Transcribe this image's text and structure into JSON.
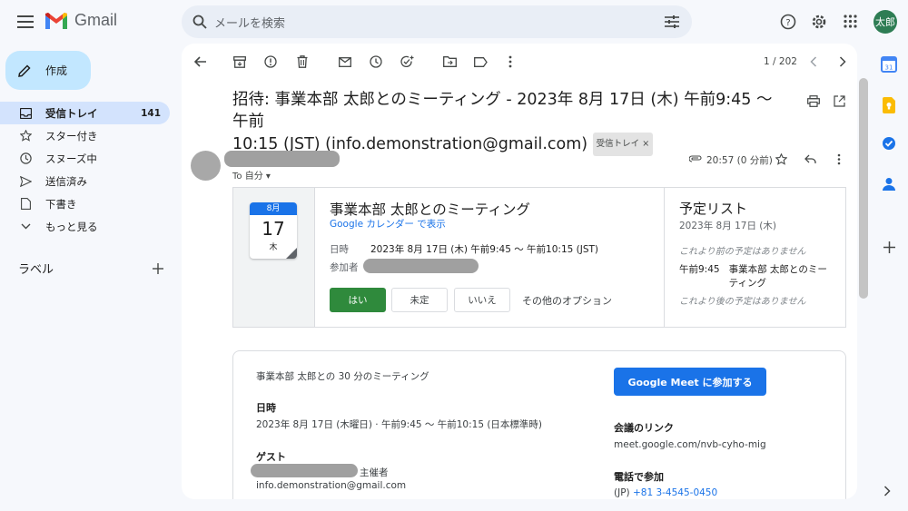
{
  "header": {
    "app_name": "Gmail",
    "search_placeholder": "メールを検索",
    "avatar_text": "太郎"
  },
  "sidebar": {
    "compose_label": "作成",
    "items": [
      {
        "label": "受信トレイ",
        "count": "141",
        "icon": "inbox-icon"
      },
      {
        "label": "スター付き",
        "icon": "star-icon"
      },
      {
        "label": "スヌーズ中",
        "icon": "clock-icon"
      },
      {
        "label": "送信済み",
        "icon": "send-icon"
      },
      {
        "label": "下書き",
        "icon": "draft-icon"
      },
      {
        "label": "もっと見る",
        "icon": "chevron-down-icon"
      }
    ],
    "labels_heading": "ラベル"
  },
  "toolbar": {
    "pager": "1 / 202"
  },
  "message": {
    "subject_line1": "招待: 事業本部 太郎とのミーティング - 2023年 8月 17日 (木) 午前9:45 〜 午前",
    "subject_line2": "10:15 (JST) (info.demonstration@gmail.com)",
    "inbox_chip": "受信トレイ ×",
    "to_me": "To 自分 ▾",
    "time": "20:57 (0 分前)"
  },
  "invite": {
    "cal_month": "8月",
    "cal_day": "17",
    "cal_dow": "木",
    "title": "事業本部 太郎とのミーティング",
    "gcal_link": "Google カレンダー で表示",
    "when_label": "日時",
    "when_value": "2023年 8月 17日 (木) 午前9:45 〜 午前10:15 (JST)",
    "guests_label": "参加者",
    "rsvp": {
      "yes": "はい",
      "maybe": "未定",
      "no": "いいえ",
      "more": "その他のオプション"
    },
    "agenda": {
      "title": "予定リスト",
      "date": "2023年 8月 17日 (木)",
      "before_note": "これより前の予定はありません",
      "event_time": "午前9:45",
      "event_title_1": "事業本部 太郎とのミー",
      "event_title_2": "ティング",
      "after_note": "これより後の予定はありません"
    }
  },
  "meet": {
    "summary": "事業本部 太郎との 30 分のミーティング",
    "when_heading": "日時",
    "when_value": "2023年 8月 17日 (木曜日) · 午前9:45 〜 午前10:15 (日本標準時)",
    "guests_heading": "ゲスト",
    "organizer_label": "主催者",
    "guest_email": "info.demonstration@gmail.com",
    "join_button": "Google Meet に参加する",
    "link_heading": "会議のリンク",
    "link_value": "meet.google.com/nvb-cyho-mig",
    "phone_heading": "電話で参加",
    "phone_prefix": "(JP) ",
    "phone_value": "+81 3-4545-0450"
  },
  "colors": {
    "accent": "#1a73e8",
    "yes_button": "#2f8a3c",
    "active_nav": "#d3e3fd",
    "compose": "#c2e7ff"
  }
}
